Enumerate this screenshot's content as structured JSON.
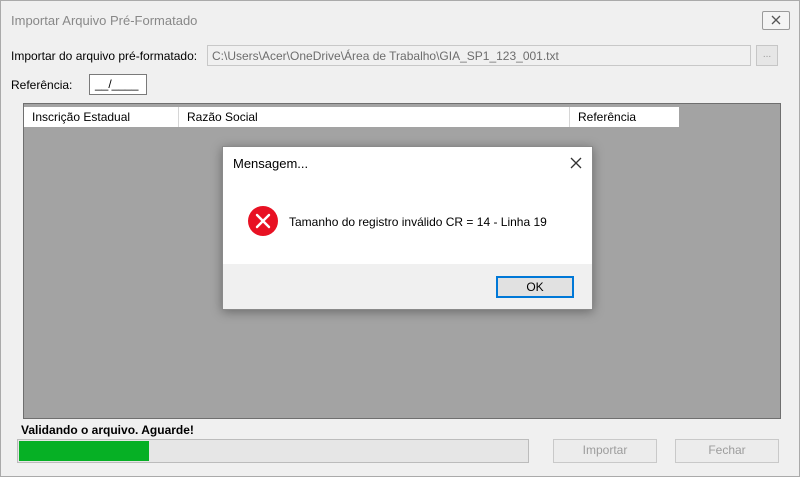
{
  "window": {
    "title": "Importar Arquivo Pré-Formatado"
  },
  "form": {
    "import_label": "Importar do arquivo pré-formatado:",
    "file_path": "C:\\Users\\Acer\\OneDrive\\Área de Trabalho\\GIA_SP1_123_001.txt",
    "browse_label": "...",
    "reference_label": "Referência:",
    "reference_value": "__/____"
  },
  "grid": {
    "columns": [
      "Inscrição Estadual",
      "Razão Social",
      "Referência"
    ]
  },
  "dialog": {
    "title": "Mensagem...",
    "message": "Tamanho do registro inválido CR = 14 - Linha 19",
    "ok_label": "OK",
    "icon": "error-icon"
  },
  "status": {
    "text": "Validando o arquivo. Aguarde!",
    "progress_fraction": 0.255
  },
  "buttons": {
    "import_label": "Importar",
    "close_label": "Fechar"
  },
  "colors": {
    "progress": "#06b025",
    "error": "#e81123",
    "focus": "#0078d7"
  }
}
